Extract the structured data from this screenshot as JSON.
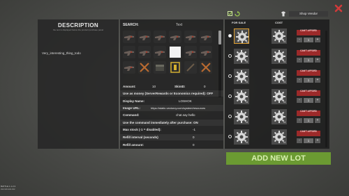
{
  "description": {
    "title": "DESCRIPTION",
    "subtitle": "the text is displayed below the product purchase panel",
    "text": "Very_interesting_thing_todo"
  },
  "editor": {
    "search_label": "SEARCH:",
    "search_value": "Text",
    "fields": {
      "amount_label": "Amount:",
      "amount_value": "10",
      "skinid_label": "SkinID:",
      "skinid_value": "0",
      "use_as_money_label": "Use as money (ServerRewards or Economics required): OFF",
      "display_name_label": "Display Name:",
      "display_name_value": "LOSHOK",
      "image_url_label": "Image URL:",
      "image_url_value": "https://static.vectorcy.com/system/resources",
      "command_label": "Command:",
      "command_value": "chat.say hello",
      "use_command_label": "Use the command immediately after purchase: ON",
      "max_stock_label": "Max stock (-1 = disabled):",
      "max_stock_value": "-1",
      "refill_interval_label": "Refill interval (seconds)",
      "refill_interval_value": "0",
      "refill_amount_label": "Refill amount:",
      "refill_amount_value": "0"
    }
  },
  "lots": {
    "for_sale_label": "FOR SALE",
    "cost_label": "COST",
    "shop_vendor_label": "Shop Vendor",
    "cant_afford_label": "CAN'T AFFORD",
    "items": [
      {
        "qty": "x1",
        "stepper_value": "1",
        "selected": true,
        "icon": "gear-icon"
      },
      {
        "qty": "x1",
        "stepper_value": "1",
        "selected": false,
        "icon": "gear-icon"
      },
      {
        "qty": "x1",
        "stepper_value": "1",
        "selected": false,
        "icon": "gear-icon"
      },
      {
        "qty": "x1",
        "stepper_value": "1",
        "selected": false,
        "icon": "gear-icon"
      },
      {
        "qty": "x1",
        "stepper_value": "1",
        "selected": false,
        "icon": "gear-icon"
      },
      {
        "qty": "x1",
        "stepper_value": "1",
        "selected": false,
        "icon": "gear-icon"
      }
    ],
    "add_new_lot_label": "ADD NEW LOT"
  },
  "colors": {
    "accent_green": "#6b9a32",
    "cant_afford_red": "#9c2a2a",
    "close_red": "#d03a3a"
  },
  "debug_text": [
    "BATTLE 1.1.2.3",
    "xxx.xxx.xxx.xxx"
  ]
}
